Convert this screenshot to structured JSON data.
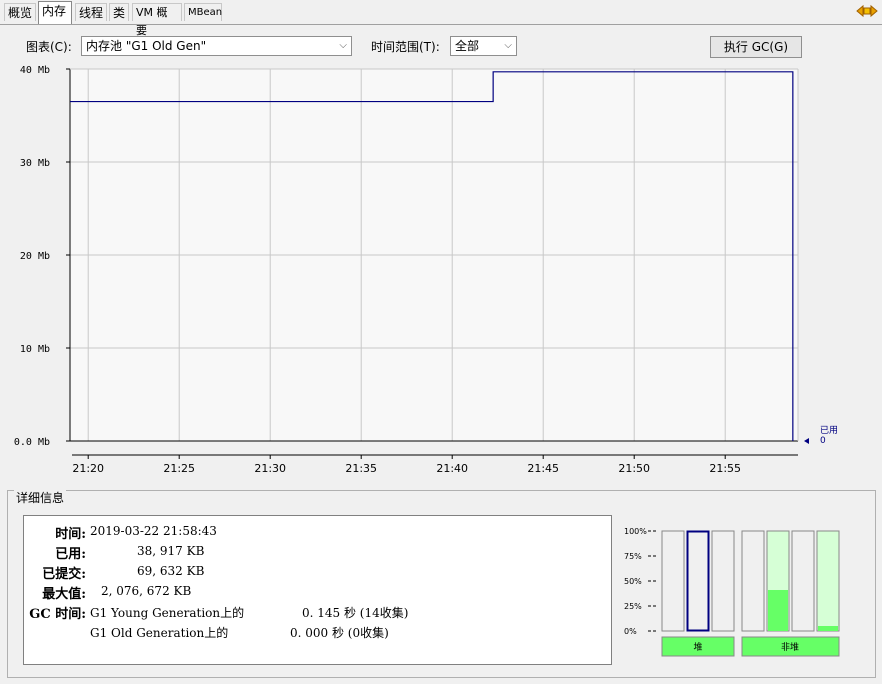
{
  "tabs": [
    "概览",
    "内存",
    "线程",
    "类",
    "VM 概要",
    "MBean"
  ],
  "active_tab": "内存",
  "controls": {
    "chart_label": "图表(C):",
    "chart_value": "内存池 \"G1 Old Gen\"",
    "time_range_label": "时间范围(T):",
    "time_range_value": "全部",
    "gc_button": "执行 GC(G)"
  },
  "chart_data": {
    "type": "line",
    "y_ticks": [
      "0.0 Mb",
      "10 Mb",
      "20 Mb",
      "30 Mb",
      "40 Mb"
    ],
    "x_ticks": [
      "21:20",
      "21:25",
      "21:30",
      "21:35",
      "21:40",
      "21:45",
      "21:50",
      "21:55"
    ],
    "ylim": [
      0,
      40
    ],
    "grid": true,
    "series": [
      {
        "name": "已用",
        "color": "#000080",
        "points": [
          [
            "21:19:00",
            36.5
          ],
          [
            "21:42:15",
            36.5
          ],
          [
            "21:42:15",
            39.7
          ],
          [
            "21:58:43",
            39.7
          ],
          [
            "21:58:43",
            0
          ]
        ]
      }
    ],
    "legend_label": "已用",
    "legend_value": "0"
  },
  "details": {
    "title": "详细信息",
    "time_label": "时间:",
    "time_value": "2019-03-22 21:58:43",
    "used_label": "已用:",
    "used_value": "38, 917 KB",
    "committed_label": "已提交:",
    "committed_value": "69, 632 KB",
    "max_label": "最大值:",
    "max_value": "2, 076, 672 KB",
    "gc_label": "GC 时间:",
    "gc_rows": [
      {
        "name": "G1 Young Generation上的",
        "value": "0. 145  秒 (14收集)"
      },
      {
        "name": "G1 Old Generation上的",
        "value": "0. 000  秒 (0收集)"
      }
    ]
  },
  "bars": {
    "ticks": [
      "100%",
      "75%",
      "50%",
      "25%",
      "0%"
    ],
    "heap_label": "堆",
    "nonheap_label": "非堆",
    "heap_levels": [
      0,
      0,
      0
    ],
    "nonheap_levels": [
      0,
      0.41,
      0,
      0.05
    ],
    "fill_color": "#66ff66",
    "selected_bar": 1
  }
}
